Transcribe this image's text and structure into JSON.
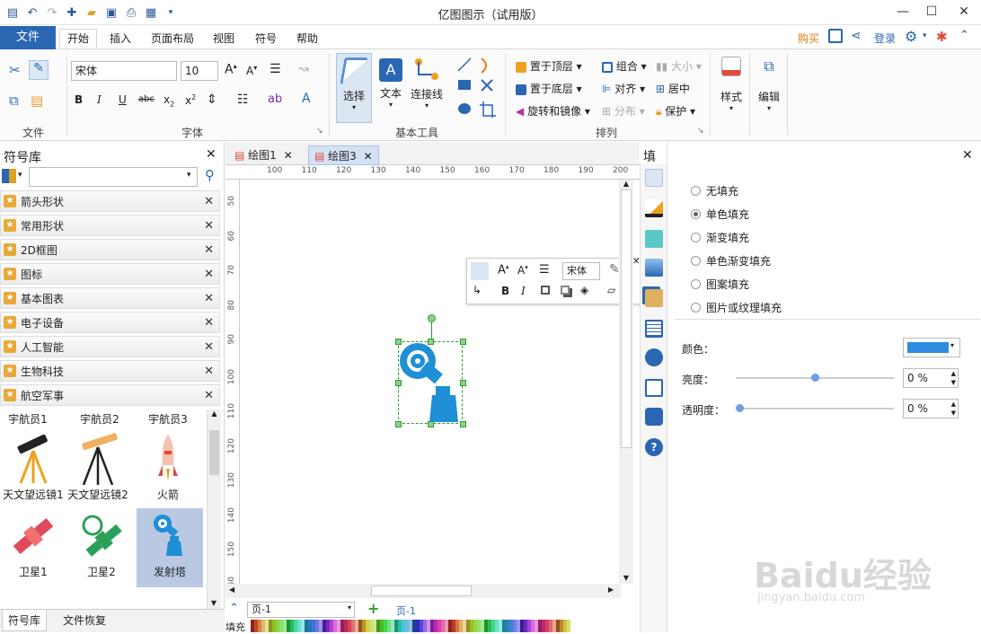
{
  "window": {
    "title": "亿图图示（试用版）",
    "minimize": "—",
    "maximize": "☐",
    "close": "✕"
  },
  "menu": {
    "file": "文件",
    "tabs": [
      "开始",
      "插入",
      "页面布局",
      "视图",
      "符号",
      "帮助"
    ],
    "buy": "购买",
    "login": "登录"
  },
  "ribbon": {
    "groups": {
      "file": "文件",
      "font": "字体",
      "basic_tools": "基本工具",
      "arrange": "排列"
    },
    "font_name": "宋体",
    "font_size": "10",
    "tools": {
      "select": "选择",
      "text": "文本",
      "connector": "连接线"
    },
    "arrange": {
      "bring_front": "置于顶层",
      "send_back": "置于底层",
      "rotate_mirror": "旋转和镜像",
      "group": "组合",
      "align": "对齐",
      "distribute": "分布",
      "size": "大小",
      "center": "居中",
      "protect": "保护"
    },
    "style": "样式",
    "edit": "编辑"
  },
  "library": {
    "title": "符号库",
    "search_placeholder": "",
    "categories": [
      "箭头形状",
      "常用形状",
      "2D框图",
      "图标",
      "基本图表",
      "电子设备",
      "人工智能",
      "生物科技",
      "航空军事"
    ],
    "symbols": [
      {
        "label": "宇航员1"
      },
      {
        "label": "宇航员2"
      },
      {
        "label": "宇航员3"
      },
      {
        "label": "天文望远镜1"
      },
      {
        "label": "天文望远镜2"
      },
      {
        "label": "火箭"
      },
      {
        "label": "卫星1"
      },
      {
        "label": "卫星2"
      },
      {
        "label": "发射塔"
      }
    ],
    "bottom_tabs": [
      "符号库",
      "文件恢复"
    ]
  },
  "documents": {
    "tabs": [
      "绘图1",
      "绘图3"
    ]
  },
  "ruler": {
    "h": [
      "100",
      "110",
      "120",
      "130",
      "140",
      "150",
      "160",
      "170",
      "180",
      "190",
      "200"
    ],
    "v": [
      "50",
      "60",
      "70",
      "80",
      "90",
      "100",
      "110",
      "120",
      "130",
      "140",
      "150",
      "160"
    ]
  },
  "floating_toolbar": {
    "font": "宋体"
  },
  "pages": {
    "current": "页-1",
    "tab": "页-1",
    "add": "+"
  },
  "status": {
    "fill_label": "填充"
  },
  "fill_panel": {
    "title": "填充",
    "options": [
      "无填充",
      "单色填充",
      "渐变填充",
      "单色渐变填充",
      "图案填充",
      "图片或纹理填充"
    ],
    "selected_index": 1,
    "color_label": "颜色：",
    "color_value": "#2f8be0",
    "brightness_label": "亮度：",
    "brightness_value": "0 %",
    "brightness_level": 0.5,
    "transparency_label": "透明度：",
    "transparency_value": "0 %",
    "transparency_level": 0.0
  },
  "colors": {
    "accent": "#2b66b3",
    "shape": "#1f8fd6",
    "selection": "#2ca02c",
    "buy": "#e07a10"
  },
  "watermark": {
    "text": "Baidu经验",
    "sub": "jingyan.baidu.com"
  }
}
